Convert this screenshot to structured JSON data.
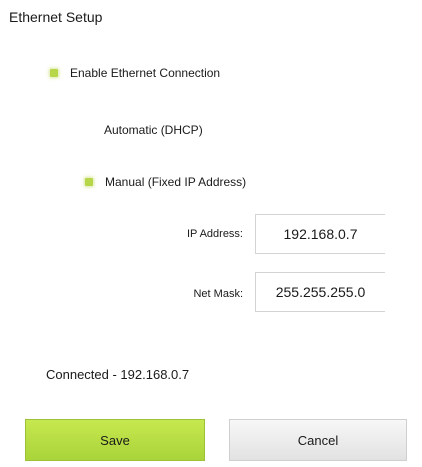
{
  "header": {
    "title": "Ethernet Setup"
  },
  "options": {
    "enable": {
      "label": "Enable Ethernet Connection",
      "selected": true
    },
    "dhcp": {
      "label": "Automatic (DHCP)",
      "selected": false
    },
    "manual": {
      "label": "Manual (Fixed IP Address)",
      "selected": true
    }
  },
  "fields": {
    "ip_address": {
      "label": "IP Address:",
      "value": "192.168.0.7"
    },
    "net_mask": {
      "label": "Net Mask:",
      "value": "255.255.255.0"
    }
  },
  "status": {
    "text": "Connected - 192.168.0.7"
  },
  "buttons": {
    "save_label": "Save",
    "cancel_label": "Cancel"
  },
  "colors": {
    "accent": "#b8d64a",
    "save_button": "#b5dc42",
    "cancel_button": "#ebebeb"
  }
}
